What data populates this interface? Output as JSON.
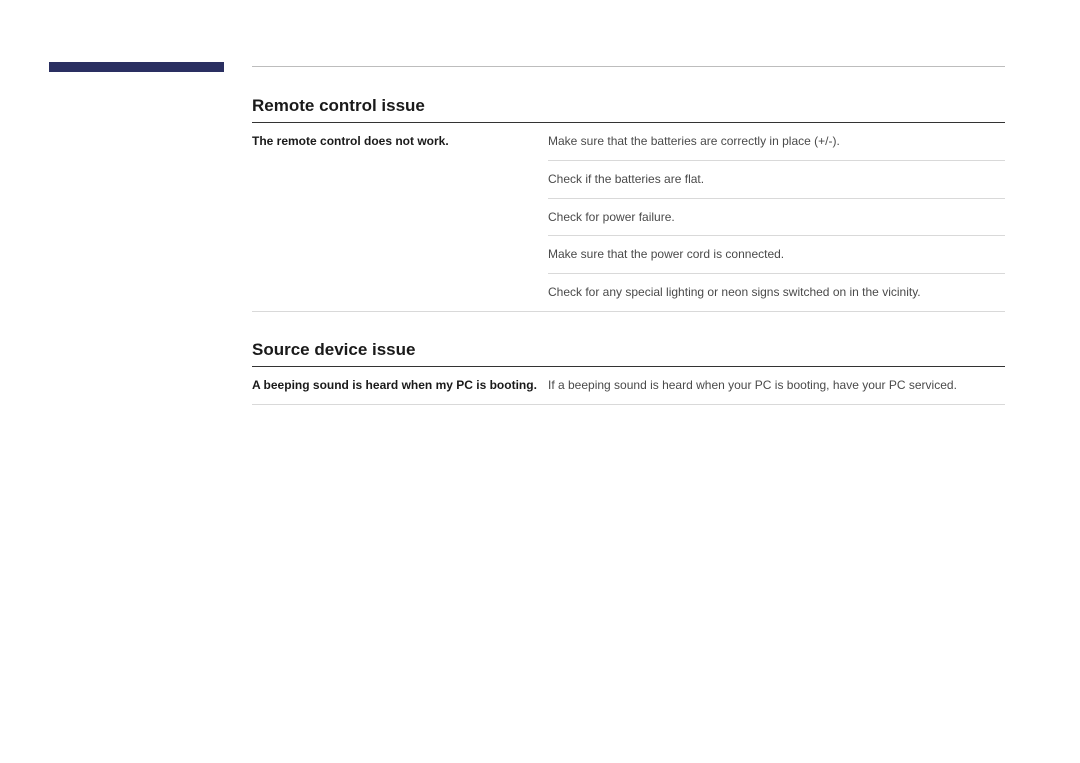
{
  "sections": [
    {
      "title": "Remote control issue",
      "rows": [
        {
          "problem": "The remote control does not work.",
          "solutions": [
            "Make sure that the batteries are correctly in place (+/-).",
            "Check if the batteries are flat.",
            "Check for power failure.",
            "Make sure that the power cord is connected.",
            "Check for any special lighting or neon signs switched on in the vicinity."
          ]
        }
      ]
    },
    {
      "title": "Source device issue",
      "rows": [
        {
          "problem": "A beeping sound is heard when my PC is booting.",
          "solutions": [
            "If a beeping sound is heard when your PC is booting, have your PC serviced."
          ]
        }
      ]
    }
  ]
}
